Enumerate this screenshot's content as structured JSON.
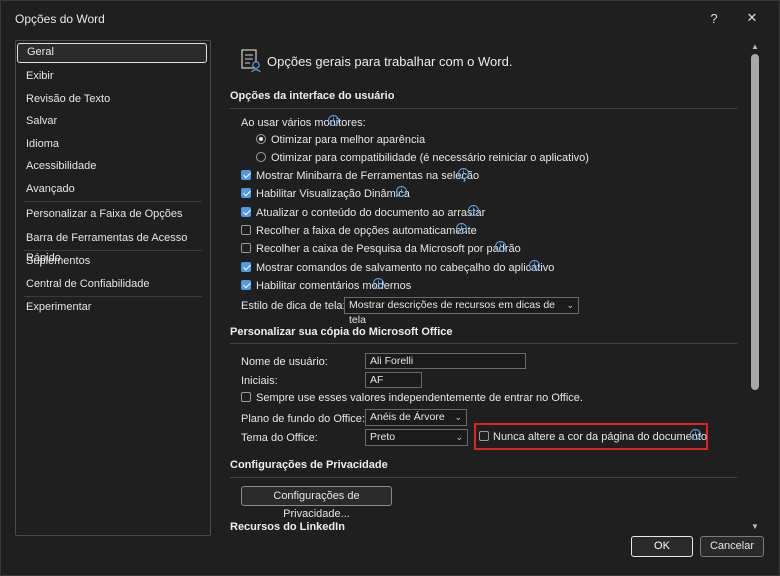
{
  "window": {
    "title": "Opções do Word",
    "help": "?",
    "close": "✕"
  },
  "nav": {
    "items": [
      {
        "label": "Geral",
        "selected": true
      },
      {
        "label": "Exibir"
      },
      {
        "label": "Revisão de Texto"
      },
      {
        "label": "Salvar"
      },
      {
        "label": "Idioma"
      },
      {
        "label": "Acessibilidade"
      },
      {
        "label": "Avançado"
      },
      {
        "label": "Personalizar a Faixa de Opções"
      },
      {
        "label": "Barra de Ferramentas de Acesso Rápido"
      },
      {
        "label": "Suplementos"
      },
      {
        "label": "Central de Confiabilidade"
      },
      {
        "label": "Experimentar"
      }
    ]
  },
  "header": {
    "text": "Opções gerais para trabalhar com o Word."
  },
  "ui_section": {
    "title": "Opções da interface do usuário",
    "monitors_label": "Ao usar vários monitores:",
    "radio_best": "Otimizar para melhor aparência",
    "radio_compat": "Otimizar para compatibilidade (é necessário reiniciar o aplicativo)",
    "cb_minibar": "Mostrar Minibarra de Ferramentas na seleção",
    "cb_preview": "Habilitar Visualização Dinâmica",
    "cb_update": "Atualizar o conteúdo do documento ao arrastar",
    "cb_collapse": "Recolher a faixa de opções automaticamente",
    "cb_search": "Recolher a caixa de Pesquisa da Microsoft por padrão",
    "cb_savecmds": "Mostrar comandos de salvamento no cabeçalho do aplicativo",
    "cb_comments": "Habilitar comentários modernos",
    "tooltip_label": "Estilo de dica de tela:",
    "tooltip_value": "Mostrar descrições de recursos em dicas de tela",
    "checks": {
      "minibar": true,
      "preview": true,
      "update": true,
      "collapse": false,
      "search": false,
      "savecmds": true,
      "comments": true
    }
  },
  "personalize": {
    "title": "Personalizar sua cópia do Microsoft Office",
    "username_label": "Nome de usuário:",
    "username_value": "Ali Forelli",
    "initials_label": "Iniciais:",
    "initials_value": "AF",
    "always_use": "Sempre use esses valores independentemente de entrar no Office.",
    "background_label": "Plano de fundo do Office:",
    "background_value": "Anéis de Árvore",
    "theme_label": "Tema do Office:",
    "theme_value": "Preto",
    "never_change": "Nunca altere a cor da página do documento"
  },
  "privacy": {
    "title": "Configurações de Privacidade",
    "button": "Configurações de Privacidade..."
  },
  "linkedin": {
    "title": "Recursos do LinkedIn"
  },
  "footer": {
    "ok": "OK",
    "cancel": "Cancelar"
  },
  "colors": {
    "accent": "#4f9ae0",
    "highlight": "#e02424",
    "background": "#1f1f1f"
  }
}
